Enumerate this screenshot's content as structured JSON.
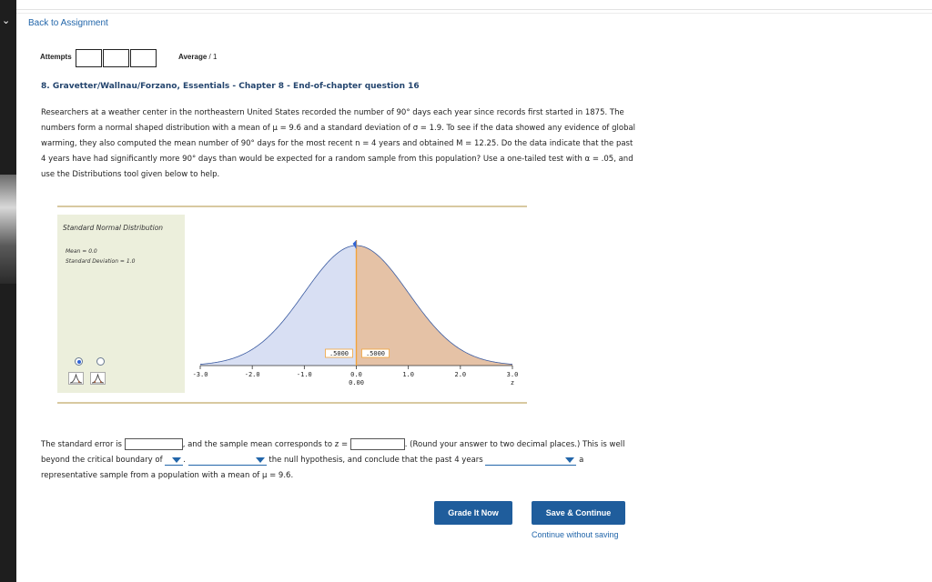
{
  "nav": {
    "back_label": "Back to Assignment"
  },
  "attempts": {
    "label": "Attempts",
    "average_label": "Average",
    "average_value": "/ 1"
  },
  "question": {
    "title": "8. Gravetter/Wallnau/Forzano, Essentials - Chapter 8 - End-of-chapter question 16",
    "text": "Researchers at a weather center in the northeastern United States recorded the number of 90° days each year since records first started in 1875. The numbers form a normal shaped distribution with a mean of μ = 9.6 and a standard deviation of σ = 1.9. To see if the data showed any evidence of global warming, they also computed the mean number of 90° days for the most recent n = 4 years and obtained M = 12.25. Do the data indicate that the past 4 years have had significantly more 90° days than would be expected for a random sample from this population? Use a one-tailed test with α = .05, and use the Distributions tool given below to help."
  },
  "tool": {
    "title": "Standard Normal Distribution",
    "mean_text": "Mean = 0.0",
    "sd_text": "Standard Deviation = 1.0",
    "left_area": ".5000",
    "right_area": ".5000",
    "x_ticks": [
      "-3.0",
      "-2.0",
      "-1.0",
      "0.0",
      "1.0",
      "2.0",
      "3.0"
    ],
    "cut_value": "0.00",
    "axis_label": "z",
    "colors": {
      "left_area": "#d8dff3",
      "right_area": "#e5c2a6",
      "cut_line": "#f2a33a"
    }
  },
  "chart_data": {
    "type": "area",
    "title": "Standard Normal Distribution",
    "mean": 0.0,
    "sd": 1.0,
    "xlim": [
      -3.0,
      3.0
    ],
    "xlabel": "z",
    "cut": 0.0,
    "series": [
      {
        "name": "left",
        "area": 0.5
      },
      {
        "name": "right",
        "area": 0.5
      }
    ]
  },
  "answer": {
    "p1": "The standard error is",
    "p2": ", and the sample mean corresponds to z =",
    "p3": ". (Round your answer to two decimal places.) This is well beyond the critical boundary of",
    "p4": ".",
    "p5": "the null hypothesis, and conclude that the past 4 years",
    "p6": "a representative sample from a population with a mean of μ = 9.6.",
    "se_value": "",
    "z_value": ""
  },
  "buttons": {
    "grade": "Grade It Now",
    "save": "Save & Continue",
    "continue": "Continue without saving"
  }
}
